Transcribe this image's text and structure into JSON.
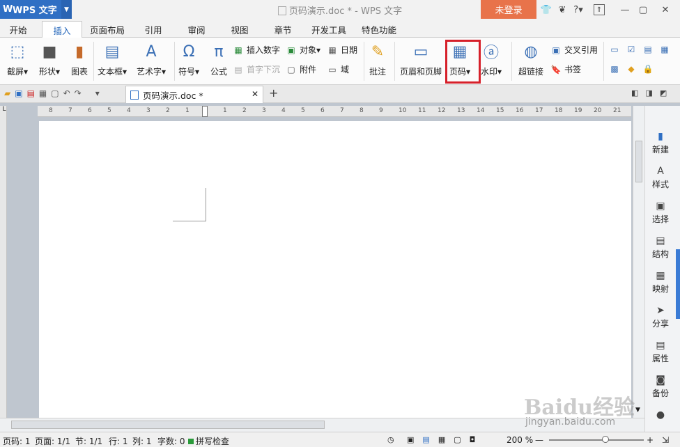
{
  "titlebar": {
    "app_name": "WPS 文字",
    "doc_title": "页码演示.doc * - WPS 文字",
    "login": "未登录",
    "icons": [
      "shirt-icon",
      "skin-icon",
      "help-icon",
      "minimize-icon",
      "restore-icon",
      "maximize-icon",
      "close-icon"
    ],
    "help": "?"
  },
  "tabs": [
    "开始",
    "插入",
    "页面布局",
    "引用",
    "审阅",
    "视图",
    "章节",
    "开发工具",
    "特色功能"
  ],
  "ribbon": {
    "screenshot": "截屏",
    "shape": "形状",
    "chart": "图表",
    "textbox": "文本框",
    "wordart": "艺术字",
    "symbol": "符号",
    "formula": "公式",
    "insert_number": "插入数字",
    "drop_cap": "首字下沉",
    "object": "对象",
    "attachment": "附件",
    "date": "日期",
    "field": "域",
    "comment": "批注",
    "header_footer": "页眉和页脚",
    "page_number": "页码",
    "watermark": "水印",
    "hyperlink": "超链接",
    "cross_ref": "交叉引用",
    "bookmark": "书签"
  },
  "doc_tab": {
    "name": "页码演示.doc *"
  },
  "ruler": {
    "left": [
      "8",
      "7",
      "6",
      "5",
      "4",
      "3",
      "2",
      "1"
    ],
    "right": [
      "1",
      "2",
      "3",
      "4",
      "5",
      "6",
      "7",
      "8",
      "9",
      "10",
      "11",
      "12",
      "13",
      "14",
      "15",
      "16",
      "17",
      "18",
      "19",
      "20",
      "21"
    ]
  },
  "side_panel": [
    "新建",
    "样式",
    "选择",
    "结构",
    "映射",
    "分享",
    "属性",
    "备份"
  ],
  "status": {
    "page": "页码: 1",
    "pages": "页面: 1/1",
    "section": "节: 1/1",
    "row": "行: 1",
    "col": "列: 1",
    "words": "字数: 0",
    "spell": "拼写检查",
    "zoom": "200 %"
  },
  "watermark": {
    "brand": "Baidu经验",
    "url": "jingyan.baidu.com"
  },
  "colors": {
    "accent": "#2f6fc4",
    "login": "#e8734a",
    "highlight": "#d6202a"
  }
}
